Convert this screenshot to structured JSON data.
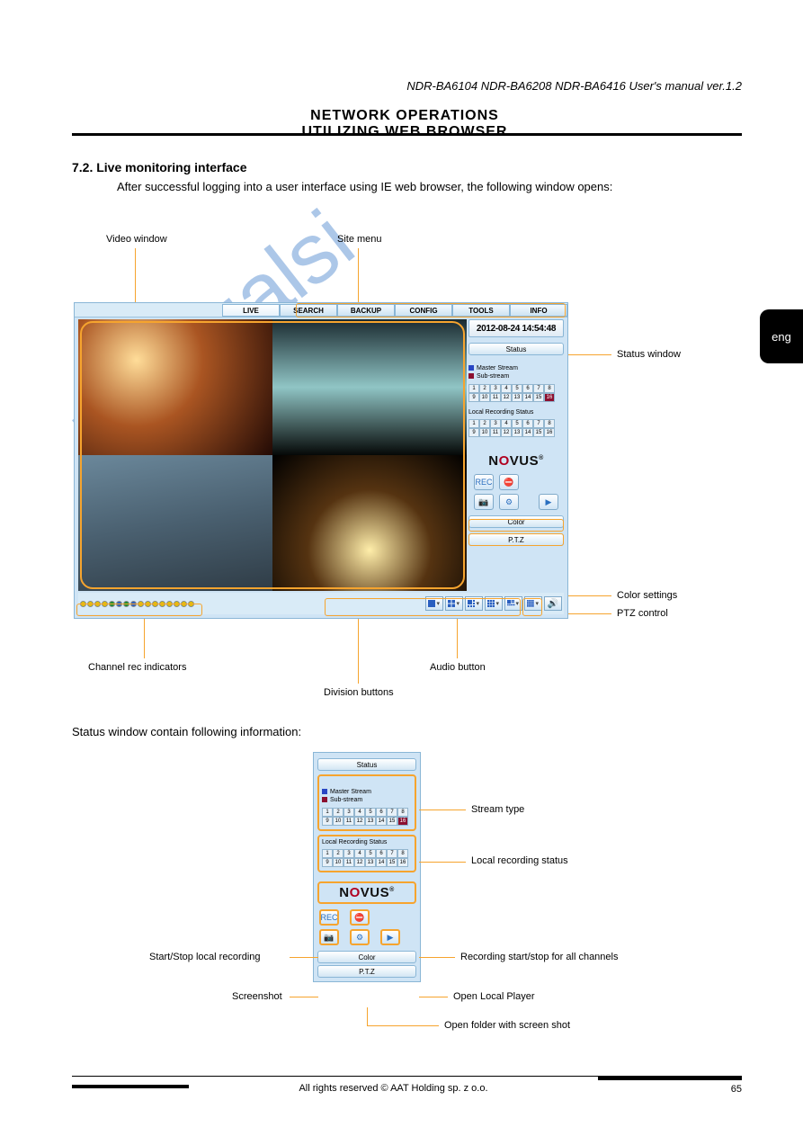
{
  "header": {
    "models": "NDR-BA6104 NDR-BA6208 NDR-BA6416 User's manual ver.1.2",
    "title": "NETWORK OPERATIONS UTILIZING WEB BROWSER"
  },
  "section": {
    "number": "7.2. Live monitoring interface",
    "intro": "After successful logging into a user interface using IE web browser, the following window opens:"
  },
  "lang_tab": "eng",
  "app": {
    "menu": {
      "live": "LIVE",
      "search": "SEARCH",
      "backup": "BACKUP",
      "config": "CONFIG",
      "tools": "TOOLS",
      "info": "INFO"
    },
    "clock": "2012-08-24 14:54:48",
    "side": {
      "status": "Status",
      "legend": {
        "master": "Master Stream",
        "sub": "Sub-stream"
      },
      "lrs": "Local Recording Status",
      "channels": [
        "1",
        "2",
        "3",
        "4",
        "5",
        "6",
        "7",
        "8",
        "9",
        "10",
        "11",
        "12",
        "13",
        "14",
        "15",
        "16"
      ],
      "brand_pre": "N",
      "brand_o": "O",
      "brand_post": "VUS",
      "brand_reg": "®",
      "color": "Color",
      "ptz": "P.T.Z"
    },
    "callouts": {
      "video_window": "Video window",
      "site_menu": "Site menu",
      "status_window": "Status window",
      "color_settings": "Color settings",
      "ptz_control": "PTZ control",
      "chan_rec_indicators": "Channel rec indicators",
      "division_buttons": "Division buttons",
      "audio_button": "Audio button"
    }
  },
  "status_section": {
    "intro": "Status window contain following information:",
    "status": "Status",
    "legend": {
      "master": "Master Stream",
      "sub": "Sub-stream"
    },
    "lrs": "Local Recording Status",
    "channels": [
      "1",
      "2",
      "3",
      "4",
      "5",
      "6",
      "7",
      "8",
      "9",
      "10",
      "11",
      "12",
      "13",
      "14",
      "15",
      "16"
    ],
    "brand_pre": "N",
    "brand_o": "O",
    "brand_post": "VUS",
    "brand_reg": "®",
    "color": "Color",
    "ptz": "P.T.Z",
    "callouts": {
      "stream_type": "Stream type",
      "local_rec_status": "Local recording status",
      "rec_start_all": "Recording start/stop for all channels",
      "start_stop_local_rec": "Start/Stop local recording",
      "open_local_player": "Open Local Player",
      "screenshot": "Screenshot",
      "open_folder_screenshot": "Open folder with screen shot"
    }
  },
  "footer": {
    "copyright": "All rights reserved © AAT Holding sp. z o.o.",
    "page": "65"
  },
  "watermark": "manualsi"
}
